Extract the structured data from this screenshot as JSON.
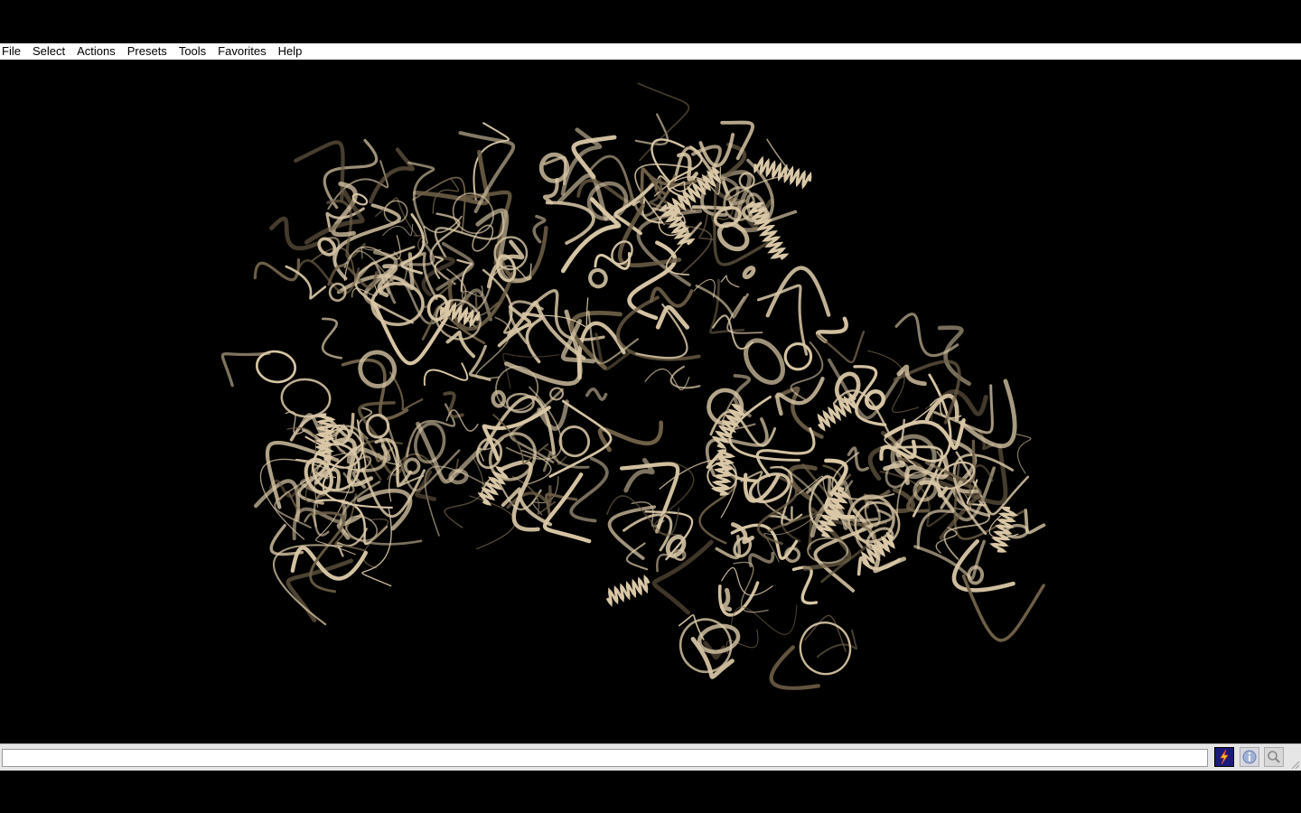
{
  "menubar": {
    "items": [
      {
        "label": "File"
      },
      {
        "label": "Select"
      },
      {
        "label": "Actions"
      },
      {
        "label": "Presets"
      },
      {
        "label": "Tools"
      },
      {
        "label": "Favorites"
      },
      {
        "label": "Help"
      }
    ]
  },
  "viewer": {
    "ribbon_color": "#d9c7a6",
    "ribbon_shadow": "#6e5f47",
    "background": "#000000"
  },
  "statusbar": {
    "command_value": "",
    "buttons": [
      {
        "icon": "lightning-icon"
      },
      {
        "icon": "info-icon"
      },
      {
        "icon": "magnifier-icon"
      }
    ]
  }
}
